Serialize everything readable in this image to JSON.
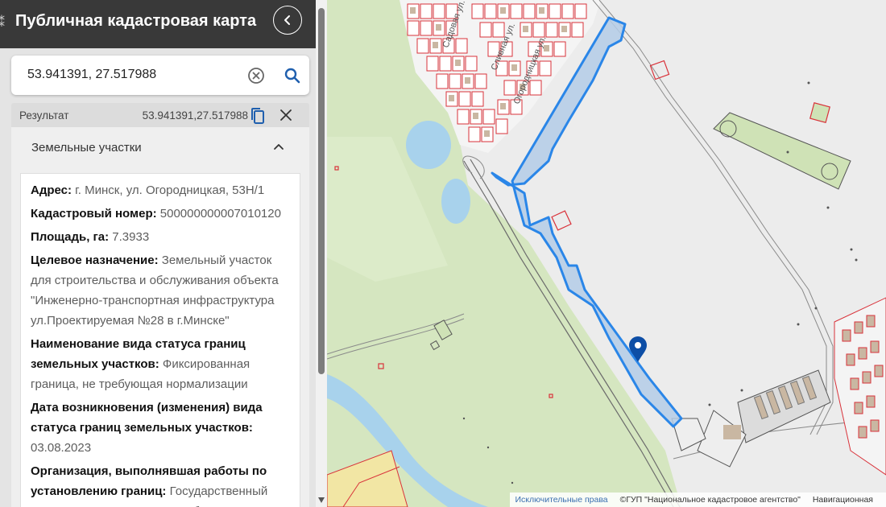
{
  "app": {
    "title": "Публичная кадастровая карта"
  },
  "search": {
    "value": "53.941391, 27.517988"
  },
  "result": {
    "label": "Результат",
    "coords": "53.941391,27.517988"
  },
  "section": {
    "title": "Земельные участки"
  },
  "details": [
    {
      "label": "Адрес:",
      "value": "г. Минск, ул. Огородницкая, 53Н/1"
    },
    {
      "label": "Кадастровый номер:",
      "value": "500000000007010120"
    },
    {
      "label": "Площадь, га:",
      "value": "7.3933"
    },
    {
      "label": "Целевое назначение:",
      "value": "Земельный участок для строительства и обслуживания объекта \"Инженерно-транспортная инфраструктура ул.Проектируемая №28 в г.Минске\""
    },
    {
      "label": "Наименование вида статуса границ земельных участков:",
      "value": "Фиксированная граница, не требующая нормализации"
    },
    {
      "label": "Дата возникновения (изменения) вида статуса границ земельных участков:",
      "value": "03.08.2023"
    },
    {
      "label": "Организация, выполнявшая работы по установлению границ:",
      "value": "Государственный комитет по имуществу Республики"
    }
  ],
  "map": {
    "street_labels": [
      "Садовая ул.",
      "Огородницкая ул.",
      "Сливная ул."
    ],
    "attribution": {
      "link": "Исключительные права",
      "copyright": "©ГУП \"Национальное кадастровое агентство\"",
      "nav": "Навигационная"
    },
    "colors": {
      "parcel_fill": "#b4cde8",
      "parcel_stroke": "#2a86e8",
      "marker": "#0d4ea6",
      "cadastre_lines": "#d9323a",
      "green_area": "#cfe2b6",
      "water": "#a8d2ec"
    }
  },
  "icons": {
    "collapse": "chevron-left-icon",
    "clear": "clear-circle-icon",
    "search": "search-icon",
    "copy": "copy-icon",
    "close": "close-icon",
    "section_toggle": "chevron-up-icon",
    "marker": "map-pin-icon"
  }
}
